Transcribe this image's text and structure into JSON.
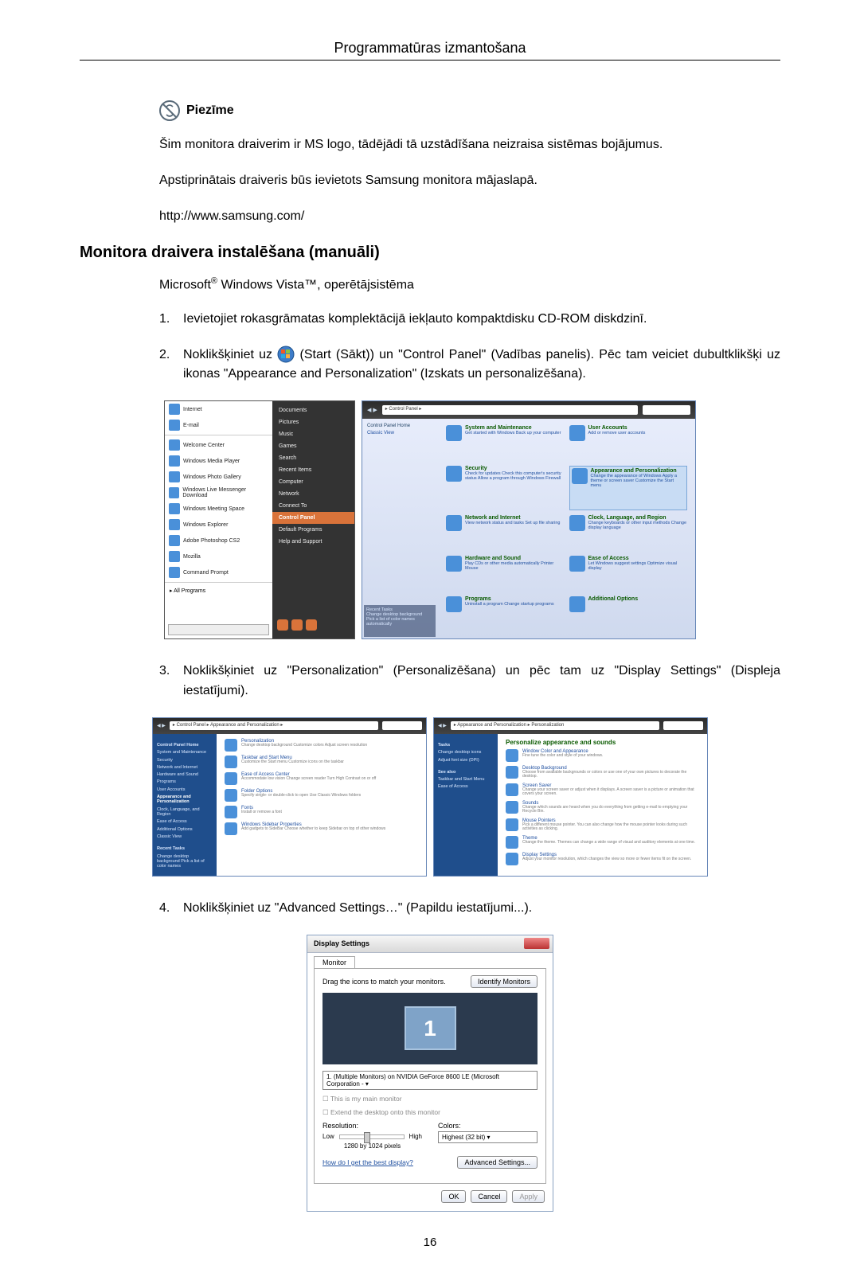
{
  "section_title": "Programmatūras izmantošana",
  "note": {
    "label": "Piezīme",
    "p1": "Šim monitora draiverim ir MS logo, tādējādi tā uzstādīšana neizraisa sistēmas bojājumus.",
    "p2": "Apstiprinātais draiveris būs ievietots Samsung monitora mājaslapā.",
    "url": "http://www.samsung.com/"
  },
  "h2": "Monitora draivera instalēšana (manuāli)",
  "subline_prefix": "Microsoft",
  "subline_rest": " Windows Vista™, operētājsistēma",
  "steps": {
    "s1_num": "1.",
    "s1": "Ievietojiet rokasgrāmatas komplektācijā iekļauto kompaktdisku CD-ROM diskdzinī.",
    "s2_num": "2.",
    "s2_a": "Noklikšķiniet uz ",
    "s2_b": "(Start (Sākt)) un \"Control Panel\" (Vadības panelis). Pēc tam veiciet dubultklikšķi uz ikonas \"Appearance and Personalization\" (Izskats un personalizēšana).",
    "s3_num": "3.",
    "s3": "Noklikšķiniet uz \"Personalization\" (Personalizēšana) un pēc tam uz \"Display Settings\" (Displeja iestatījumi).",
    "s4_num": "4.",
    "s4": "Noklikšķiniet uz \"Advanced Settings…\" (Papildu iestatījumi...)."
  },
  "startmenu": {
    "items": [
      "Internet",
      "E-mail",
      "Welcome Center",
      "Windows Media Player",
      "Windows Photo Gallery",
      "Windows Live Messenger Download",
      "Windows Meeting Space",
      "Windows Explorer",
      "Adobe Photoshop CS2",
      "Mozilla",
      "Command Prompt"
    ],
    "all_programs": "All Programs",
    "right": [
      "Documents",
      "Pictures",
      "Music",
      "Games",
      "Search",
      "Recent Items",
      "Computer",
      "Network",
      "Connect To",
      "Control Panel",
      "Default Programs",
      "Help and Support"
    ]
  },
  "cpanel": {
    "addr": "▸ Control Panel ▸",
    "side_head": "Control Panel Home",
    "side_item": "Classic View",
    "recent_title": "Recent Tasks",
    "recent_items": [
      "Change desktop background",
      "Pick a list of color names automatically"
    ],
    "cats": [
      {
        "title": "System and Maintenance",
        "sub": "Get started with Windows\nBack up your computer"
      },
      {
        "title": "User Accounts",
        "sub": "Add or remove user accounts"
      },
      {
        "title": "Security",
        "sub": "Check for updates\nCheck this computer's security status\nAllow a program through Windows Firewall"
      },
      {
        "title": "Appearance and Personalization",
        "sub": "Change the appearance of Windows\nApply a theme or screen saver\nCustomize the Start menu"
      },
      {
        "title": "Network and Internet",
        "sub": "View network status and tasks\nSet up file sharing"
      },
      {
        "title": "Clock, Language, and Region",
        "sub": "Change keyboards or other input methods\nChange display language"
      },
      {
        "title": "Hardware and Sound",
        "sub": "Play CDs or other media automatically\nPrinter\nMouse"
      },
      {
        "title": "Ease of Access",
        "sub": "Let Windows suggest settings\nOptimize visual display"
      },
      {
        "title": "Programs",
        "sub": "Uninstall a program\nChange startup programs"
      },
      {
        "title": "Additional Options",
        "sub": ""
      }
    ]
  },
  "pwin1": {
    "addr": "▸ Control Panel ▸ Appearance and Personalization ▸",
    "side_head": "Control Panel Home",
    "side": [
      "System and Maintenance",
      "Security",
      "Network and Internet",
      "Hardware and Sound",
      "Programs",
      "User Accounts",
      "Appearance and Personalization",
      "Clock, Language, and Region",
      "Ease of Access",
      "Additional Options",
      "Classic View"
    ],
    "links": [
      {
        "t": "Personalization",
        "s": "Change desktop background   Customize colors   Adjust screen resolution"
      },
      {
        "t": "Taskbar and Start Menu",
        "s": "Customize the Start menu   Customize icons on the taskbar"
      },
      {
        "t": "Ease of Access Center",
        "s": "Accommodate low vision   Change screen reader   Turn High Contrast on or off"
      },
      {
        "t": "Folder Options",
        "s": "Specify single- or double-click to open   Use Classic Windows folders"
      },
      {
        "t": "Fonts",
        "s": "Install or remove a font"
      },
      {
        "t": "Windows Sidebar Properties",
        "s": "Add gadgets to SideBar   Choose whether to keep Sidebar on top of other windows"
      }
    ],
    "recent_title": "Recent Tasks",
    "recent": "Change desktop background\nPick a list of color names"
  },
  "pwin2": {
    "addr": "▸ Appearance and Personalization ▸ Personalization",
    "side": [
      "Tasks",
      "Change desktop icons",
      "Adjust font size (DPI)"
    ],
    "headline": "Personalize appearance and sounds",
    "links": [
      {
        "t": "Window Color and Appearance",
        "s": "Fine tune the color and style of your windows."
      },
      {
        "t": "Desktop Background",
        "s": "Choose from available backgrounds or colors or use one of your own pictures to decorate the desktop."
      },
      {
        "t": "Screen Saver",
        "s": "Change your screen saver or adjust when it displays. A screen saver is a picture or animation that covers your screen."
      },
      {
        "t": "Sounds",
        "s": "Change which sounds are heard when you do everything from getting e-mail to emptying your Recycle Bin."
      },
      {
        "t": "Mouse Pointers",
        "s": "Pick a different mouse pointer. You can also change how the mouse pointer looks during such activities as clicking."
      },
      {
        "t": "Theme",
        "s": "Change the theme. Themes can change a wide range of visual and auditory elements at one time."
      },
      {
        "t": "Display Settings",
        "s": "Adjust your monitor resolution, which changes the view so more or fewer items fit on the screen."
      }
    ],
    "seealso_title": "See also",
    "seealso": [
      "Taskbar and Start Menu",
      "Ease of Access"
    ]
  },
  "ds": {
    "title": "Display Settings",
    "tab": "Monitor",
    "drag": "Drag the icons to match your monitors.",
    "identify": "Identify Monitors",
    "mon_num": "1",
    "drop": "1. (Multiple Monitors) on NVIDIA GeForce 8600 LE (Microsoft Corporation - ▾",
    "chk1": "This is my main monitor",
    "chk2": "Extend the desktop onto this monitor",
    "res_label": "Resolution:",
    "res_low": "Low",
    "res_high": "High",
    "res_value": "1280 by 1024 pixels",
    "col_label": "Colors:",
    "col_value": "Highest (32 bit)    ▾",
    "help": "How do I get the best display?",
    "adv": "Advanced Settings...",
    "ok": "OK",
    "cancel": "Cancel",
    "apply": "Apply"
  },
  "page_number": "16"
}
